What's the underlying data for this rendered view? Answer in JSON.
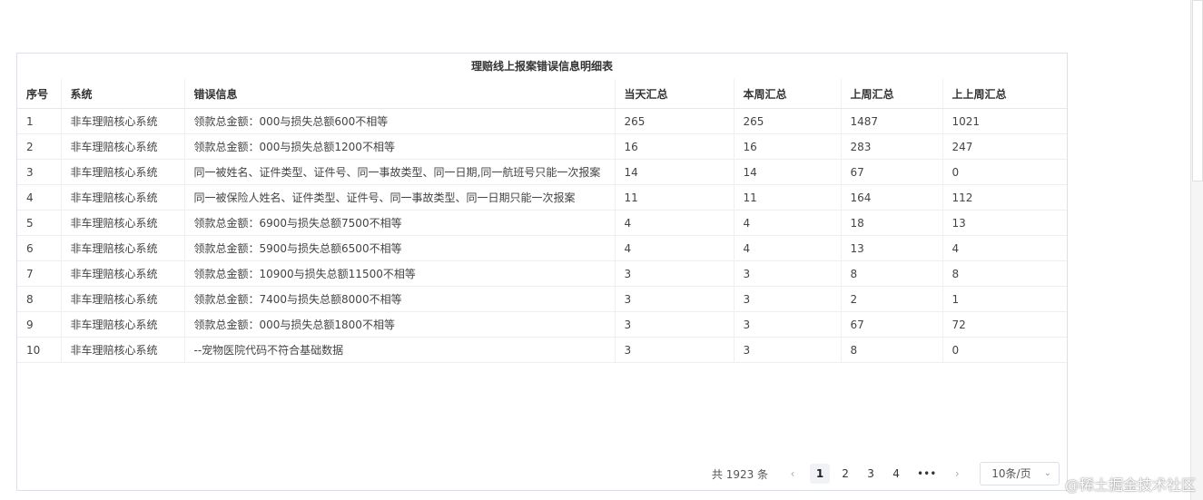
{
  "report": {
    "title": "理赔线上报案错误信息明细表",
    "columns": [
      "序号",
      "系统",
      "错误信息",
      "当天汇总",
      "本周汇总",
      "上周汇总",
      "上上周汇总"
    ],
    "rows": [
      [
        "1",
        "非车理赔核心系统",
        "领款总金额：000与损失总额600不相等",
        "265",
        "265",
        "1487",
        "1021"
      ],
      [
        "2",
        "非车理赔核心系统",
        "领款总金额：000与损失总额1200不相等",
        "16",
        "16",
        "283",
        "247"
      ],
      [
        "3",
        "非车理赔核心系统",
        "同一被姓名、证件类型、证件号、同一事故类型、同一日期,同一航班号只能一次报案",
        "14",
        "14",
        "67",
        "0"
      ],
      [
        "4",
        "非车理赔核心系统",
        "同一被保险人姓名、证件类型、证件号、同一事故类型、同一日期只能一次报案",
        "11",
        "11",
        "164",
        "112"
      ],
      [
        "5",
        "非车理赔核心系统",
        "领款总金额：6900与损失总额7500不相等",
        "4",
        "4",
        "18",
        "13"
      ],
      [
        "6",
        "非车理赔核心系统",
        "领款总金额：5900与损失总额6500不相等",
        "4",
        "4",
        "13",
        "4"
      ],
      [
        "7",
        "非车理赔核心系统",
        "领款总金额：10900与损失总额11500不相等",
        "3",
        "3",
        "8",
        "8"
      ],
      [
        "8",
        "非车理赔核心系统",
        "领款总金额：7400与损失总额8000不相等",
        "3",
        "3",
        "2",
        "1"
      ],
      [
        "9",
        "非车理赔核心系统",
        "领款总金额：000与损失总额1800不相等",
        "3",
        "3",
        "67",
        "72"
      ],
      [
        "10",
        "非车理赔核心系统",
        "--宠物医院代码不符合基础数据",
        "3",
        "3",
        "8",
        "0"
      ]
    ]
  },
  "pagination": {
    "total_text": "共 1923 条",
    "prev_icon": "‹",
    "pages": [
      "1",
      "2",
      "3",
      "4"
    ],
    "active_page": "1",
    "ellipsis": "•••",
    "next_icon": "›",
    "page_size": "10条/页",
    "chevron_icon": "⌄"
  },
  "corner_mark": "@稀土掘金技术社区"
}
